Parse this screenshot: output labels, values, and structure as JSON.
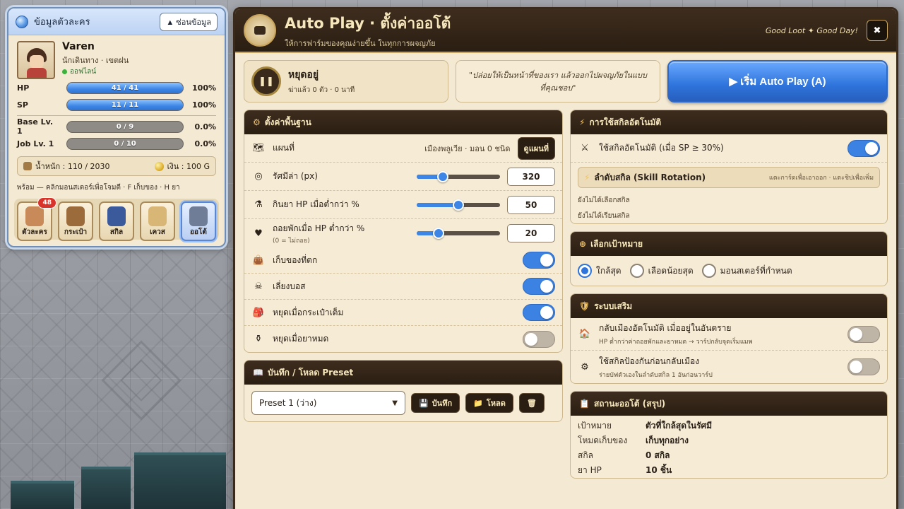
{
  "character_panel": {
    "title": "ข้อมูลตัวละคร",
    "hide_button": "▲ ซ่อนข้อมูล",
    "name": "Varen",
    "class_location": "นักเดินทาง · เขตฝน",
    "status": "ออฟไลน์",
    "stats": [
      {
        "label": "HP",
        "text": "41 / 41",
        "fraction": 1.0,
        "pct": "100%"
      },
      {
        "label": "SP",
        "text": "11 / 11",
        "fraction": 1.0,
        "pct": "100%"
      },
      {
        "label": "Base Lv. 1",
        "text": "0 / 9",
        "fraction": 0.0,
        "pct": "0.0%"
      },
      {
        "label": "Job Lv. 1",
        "text": "0 / 10",
        "fraction": 0.0,
        "pct": "0.0%"
      }
    ],
    "weight": "น้ำหนัก : 110 / 2030",
    "money": "เงิน : 100 G",
    "hint": "พร้อม — คลิกมอนสเตอร์เพื่อโจมตี · F เก็บของ · H ยา",
    "dock": [
      {
        "label": "ตัวละคร",
        "icon": "character-icon",
        "badge": "48",
        "active": false,
        "color": "#c98a5a"
      },
      {
        "label": "กระเป๋า",
        "icon": "bag-icon",
        "badge": "",
        "active": false,
        "color": "#9b6b3c"
      },
      {
        "label": "สกิล",
        "icon": "skill-book-icon",
        "badge": "",
        "active": false,
        "color": "#3a5a9b"
      },
      {
        "label": "เควส",
        "icon": "quest-scroll-icon",
        "badge": "",
        "active": false,
        "color": "#d8b676"
      },
      {
        "label": "ออโต้",
        "icon": "gear-icon",
        "badge": "",
        "active": true,
        "color": "#6f7d96"
      }
    ]
  },
  "autoplay": {
    "title": "Auto Play · ตั้งค่าออโต้",
    "subtitle": "ให้การฟาร์มของคุณง่ายขึ้น ในทุกการผจญภัย",
    "tagline": "Good Loot ✦ Good Day!",
    "close": "✖",
    "status_title": "หยุดอยู่",
    "status_sub": "ฆ่าแล้ว 0 ตัว · 0 นาที",
    "quote": "\"ปล่อยให้เป็นหน้าที่ของเรา แล้วออกไปผจญภัยในแบบที่คุณชอบ\"",
    "start_button": "▶ เริ่ม Auto Play (A)",
    "basic": {
      "title": "ตั้งค่าพื้นฐาน",
      "map_label": "แผนที่",
      "map_info": "เมืองพลูเวีย · มอน 0 ชนิด",
      "map_button": "ดูแผนที่",
      "sliders": [
        {
          "label": "รัศมีล่า (px)",
          "sublabel": "",
          "value": "320",
          "fraction": 0.31,
          "icon": "target-icon",
          "glyph": "◎"
        },
        {
          "label": "กินยา HP เมื่อต่ำกว่า %",
          "sublabel": "",
          "value": "50",
          "fraction": 0.5,
          "icon": "potion-icon",
          "glyph": "⚗"
        },
        {
          "label": "ถอยพักเมื่อ HP ต่ำกว่า %",
          "sublabel": "(0 = ไม่ถอย)",
          "value": "20",
          "fraction": 0.26,
          "icon": "heart-icon",
          "glyph": "♥"
        }
      ],
      "toggles": [
        {
          "label": "เก็บของที่ตก",
          "on": true,
          "icon": "loot-bag-icon",
          "glyph": "👜"
        },
        {
          "label": "เลี่ยงบอส",
          "on": true,
          "icon": "boss-icon",
          "glyph": "☠"
        },
        {
          "label": "หยุดเมื่อกระเป๋าเต็ม",
          "on": true,
          "icon": "backpack-icon",
          "glyph": "🎒"
        },
        {
          "label": "หยุดเมื่อยาหมด",
          "on": false,
          "icon": "empty-potion-icon",
          "glyph": "⚱"
        }
      ]
    },
    "preset": {
      "title": "บันทึก / โหลด Preset",
      "selected": "Preset 1 (ว่าง)",
      "save": "บันทึก",
      "load": "โหลด"
    },
    "skills": {
      "title": "การใช้สกิลอัตโนมัติ",
      "auto_skill_label": "ใช้สกิลอัตโนมัติ (เมื่อ SP ≥ 30%)",
      "auto_skill_on": true,
      "rotation_title": "ลำดับสกิล (Skill Rotation)",
      "rotation_hint": "แตะการ์ดเพื่อเอาออก · แตะชิปเพื่อเพิ่ม",
      "empty1": "ยังไม่ได้เลือกสกิล",
      "empty2": "ยังไม่ได้เรียนสกิล"
    },
    "target": {
      "title": "เลือกเป้าหมาย",
      "options": [
        {
          "label": "ใกล้สุด",
          "selected": true
        },
        {
          "label": "เลือดน้อยสุด",
          "selected": false
        },
        {
          "label": "มอนสเตอร์ที่กำหนด",
          "selected": false
        }
      ]
    },
    "aux": {
      "title": "ระบบเสริม",
      "items": [
        {
          "title": "กลับเมืองอัตโนมัติ เมื่ออยู่ในอันตราย",
          "sub": "HP ต่ำกว่าค่าถอยพักและยาหมด → วาร์ปกลับจุดเริ่มแมพ",
          "on": false,
          "icon": "house-icon",
          "glyph": "🏠"
        },
        {
          "title": "ใช้สกิลป้องกันก่อนกลับเมือง",
          "sub": "ร่ายบัฟตัวเองในลำดับสกิล 1 อันก่อนวาร์ป",
          "on": false,
          "icon": "gear-small-icon",
          "glyph": "⚙"
        }
      ]
    },
    "summary": {
      "title": "สถานะออโต้ (สรุป)",
      "rows": [
        {
          "k": "เป้าหมาย",
          "v": "ตัวที่ใกล้สุดในรัศมี"
        },
        {
          "k": "โหมดเก็บของ",
          "v": "เก็บทุกอย่าง"
        },
        {
          "k": "สกิล",
          "v": "0 สกิล"
        },
        {
          "k": "ยา HP",
          "v": "10 ชิ้น"
        }
      ]
    }
  }
}
